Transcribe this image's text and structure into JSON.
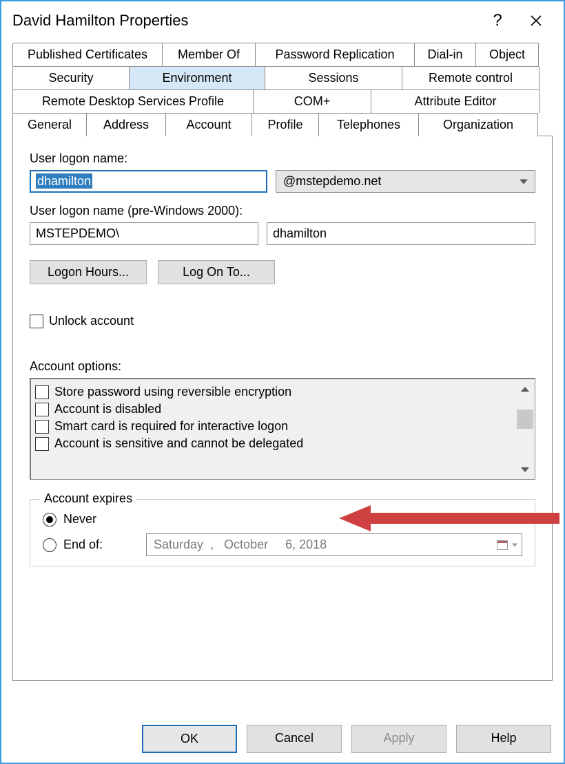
{
  "title": "David Hamilton Properties",
  "tabs": {
    "row1": [
      "Published Certificates",
      "Member Of",
      "Password Replication",
      "Dial-in",
      "Object"
    ],
    "row2": [
      "Security",
      "Environment",
      "Sessions",
      "Remote control"
    ],
    "row3": [
      "Remote Desktop Services Profile",
      "COM+",
      "Attribute Editor"
    ],
    "row4": [
      "General",
      "Address",
      "Account",
      "Profile",
      "Telephones",
      "Organization"
    ]
  },
  "labels": {
    "logon": "User logon name:",
    "preWindows": "User logon name (pre-Windows 2000):",
    "accountOptions": "Account options:",
    "accountExpires": "Account expires"
  },
  "logon": {
    "username": "dhamilton",
    "domain": "@mstepdemo.net"
  },
  "pre": {
    "domain": "MSTEPDEMO\\",
    "username": "dhamilton"
  },
  "buttons": {
    "logonHours": "Logon Hours...",
    "logOnTo": "Log On To..."
  },
  "unlockLabel": "Unlock account",
  "options": [
    "Store password using reversible encryption",
    "Account is disabled",
    "Smart card is required for interactive logon",
    "Account is sensitive and cannot be delegated"
  ],
  "expires": {
    "never": "Never",
    "endOf": "End of:",
    "date": "Saturday  ,   October     6, 2018"
  },
  "footer": {
    "ok": "OK",
    "cancel": "Cancel",
    "apply": "Apply",
    "help": "Help"
  }
}
